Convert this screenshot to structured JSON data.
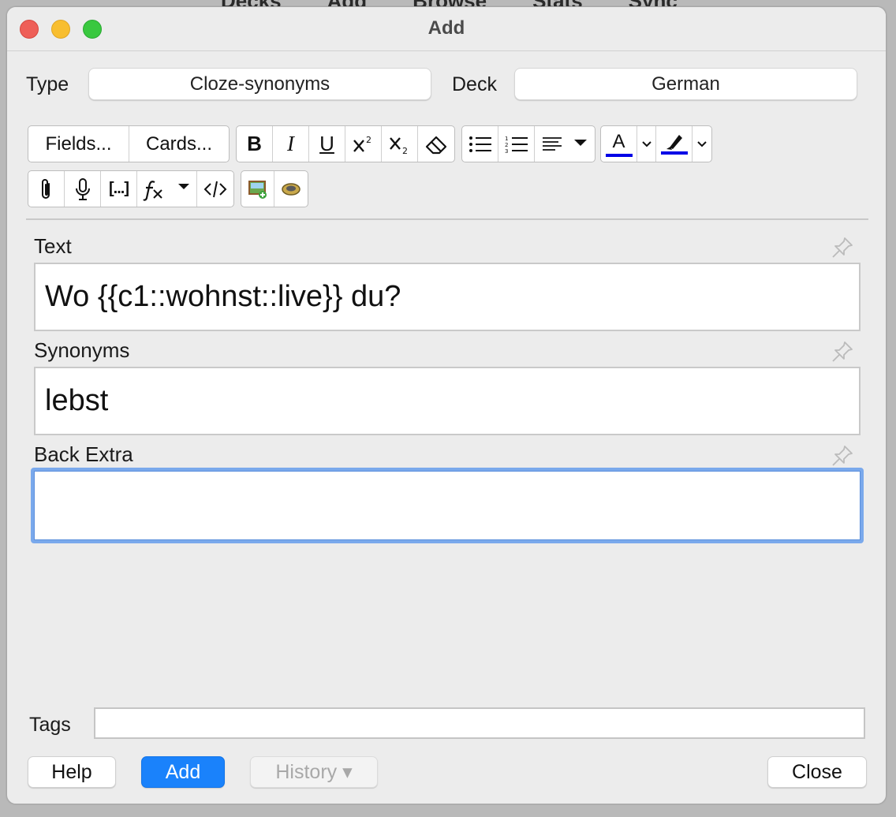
{
  "background_menu": [
    "Decks",
    "Add",
    "Browse",
    "Stats",
    "Sync"
  ],
  "window": {
    "title": "Add"
  },
  "type": {
    "label": "Type",
    "value": "Cloze-synonyms"
  },
  "deck": {
    "label": "Deck",
    "value": "German"
  },
  "toolbar": {
    "fields_label": "Fields...",
    "cards_label": "Cards...",
    "bold": "B",
    "italic": "I",
    "underline": "U",
    "cloze": "[...]",
    "text_color": "A"
  },
  "fields": [
    {
      "label": "Text",
      "value": "Wo {{c1::wohnst::live}} du?"
    },
    {
      "label": "Synonyms",
      "value": "lebst"
    },
    {
      "label": "Back Extra",
      "value": ""
    }
  ],
  "tags": {
    "label": "Tags",
    "value": ""
  },
  "buttons": {
    "help": "Help",
    "add": "Add",
    "history": "History ▾",
    "close": "Close"
  },
  "colors": {
    "accent": "#1a82fb",
    "focus_ring": "#7aa9ec",
    "text_color_bar": "#0000e6",
    "highlight_bar": "#0000e6"
  }
}
